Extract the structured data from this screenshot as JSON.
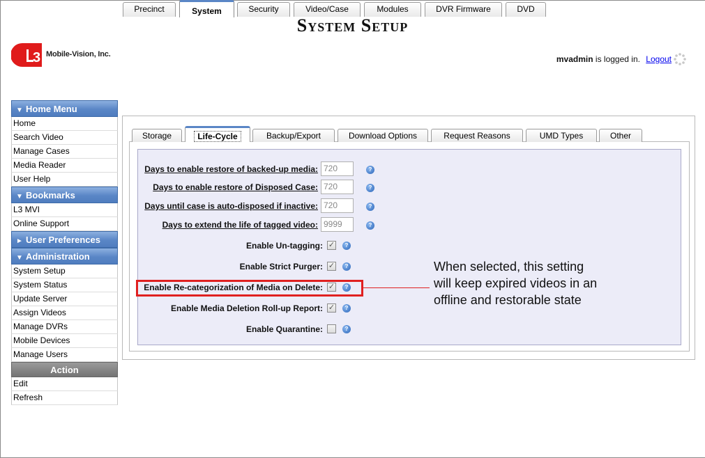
{
  "header": {
    "title": "System Setup",
    "logo_text": "Mobile-Vision, Inc.",
    "logged_user": "mvadmin",
    "logged_suffix": "is logged in.",
    "logout_label": "Logout"
  },
  "sidebar": {
    "home_menu": {
      "title": "Home Menu",
      "items": [
        "Home",
        "Search Video",
        "Manage Cases",
        "Media Reader",
        "User Help"
      ]
    },
    "bookmarks": {
      "title": "Bookmarks",
      "items": [
        "L3 MVI",
        "Online Support"
      ]
    },
    "user_prefs": {
      "title": "User Preferences"
    },
    "administration": {
      "title": "Administration",
      "items": [
        "System Setup",
        "System Status",
        "Update Server",
        "Assign Videos",
        "Manage DVRs",
        "Mobile Devices",
        "Manage Users"
      ]
    },
    "action": {
      "title": "Action",
      "items": [
        "Edit",
        "Refresh"
      ]
    }
  },
  "tabs": [
    "Precinct",
    "System",
    "Security",
    "Video/Case",
    "Modules",
    "DVR Firmware",
    "DVD"
  ],
  "active_tab": "System",
  "subtabs": [
    "Storage",
    "Life-Cycle",
    "Backup/Export",
    "Download Options",
    "Request Reasons",
    "UMD Types",
    "Other"
  ],
  "active_subtab": "Life-Cycle",
  "settings": {
    "restore_backed_up": {
      "label": "Days to enable restore of backed-up media:",
      "value": "720"
    },
    "restore_disposed": {
      "label": "Days to enable restore of Disposed Case:",
      "value": "720"
    },
    "auto_dispose": {
      "label": "Days until case is auto-disposed if inactive:",
      "value": "720"
    },
    "extend_tagged": {
      "label": "Days to extend the life of tagged video:",
      "value": "9999"
    },
    "untagging": {
      "label": "Enable Un-tagging:",
      "checked": true
    },
    "strict_purger": {
      "label": "Enable Strict Purger:",
      "checked": true
    },
    "recategorization": {
      "label": "Enable Re-categorization of Media on Delete:",
      "checked": true
    },
    "rollup_report": {
      "label": "Enable Media Deletion Roll-up Report:",
      "checked": true
    },
    "quarantine": {
      "label": "Enable Quarantine:",
      "checked": false
    }
  },
  "callout": {
    "line1": "When selected, this setting",
    "line2": "will keep expired videos in an",
    "line3": "offline and restorable state"
  },
  "colors": {
    "sidebar_header": "#5a86c6",
    "highlight": "#e02020",
    "content_bg": "#ececf8",
    "link": "#0000ee"
  }
}
